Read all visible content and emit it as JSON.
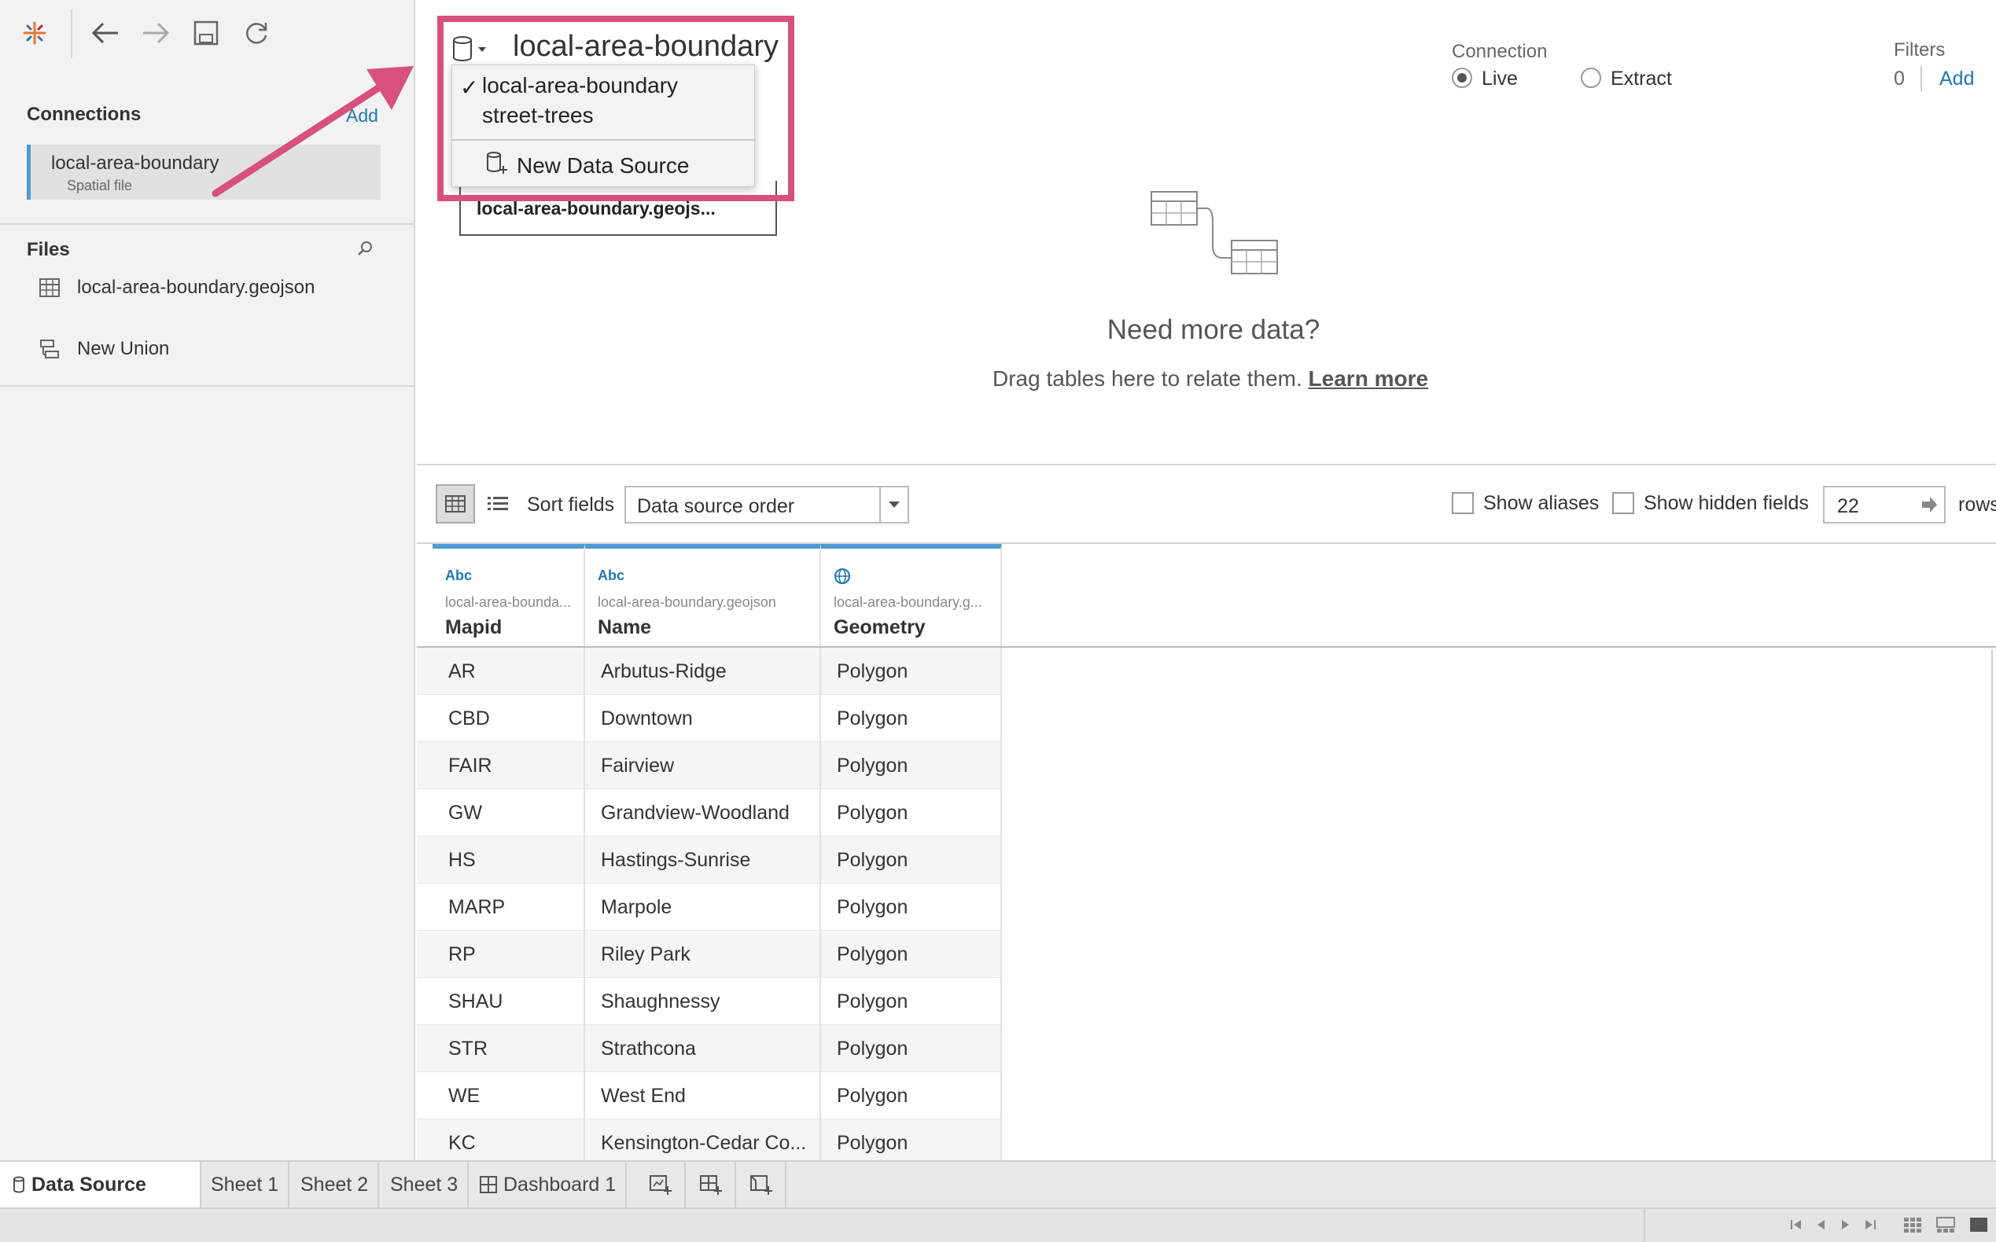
{
  "toolbar": {
    "icons": [
      "tableau-logo-icon",
      "back-icon",
      "forward-icon",
      "save-icon",
      "refresh-icon"
    ]
  },
  "sidebar": {
    "connections_title": "Connections",
    "connections_add": "Add",
    "connection": {
      "name": "local-area-boundary",
      "type": "Spatial file"
    },
    "files_title": "Files",
    "files": [
      {
        "label": "local-area-boundary.geojson",
        "icon": "table-icon"
      },
      {
        "label": "New Union",
        "icon": "union-icon"
      }
    ]
  },
  "header": {
    "datasource_title": "local-area-boundary",
    "dropdown": {
      "items": [
        "local-area-boundary",
        "street-trees"
      ],
      "checked_index": 0,
      "new_source": "New Data Source"
    },
    "table_card": "local-area-boundary.geojs...",
    "connection_label": "Connection",
    "connection_options": [
      "Live",
      "Extract"
    ],
    "connection_selected": "Live",
    "filters_label": "Filters",
    "filters_count": "0",
    "filters_add": "Add",
    "need_more": "Need more data?",
    "drag_text": "Drag tables here to relate them.",
    "learn_more": "Learn more"
  },
  "grid_toolbar": {
    "sort_label": "Sort fields",
    "sort_value": "Data source order",
    "show_aliases": "Show aliases",
    "show_hidden": "Show hidden fields",
    "rows_value": "22",
    "rows_label": "rows"
  },
  "grid": {
    "columns": [
      {
        "type": "Abc",
        "source": "local-area-bounda...",
        "name": "Mapid"
      },
      {
        "type": "Abc",
        "source": "local-area-boundary.geojson",
        "name": "Name"
      },
      {
        "type": "globe",
        "source": "local-area-boundary.g...",
        "name": "Geometry"
      }
    ],
    "rows": [
      [
        "AR",
        "Arbutus-Ridge",
        "Polygon"
      ],
      [
        "CBD",
        "Downtown",
        "Polygon"
      ],
      [
        "FAIR",
        "Fairview",
        "Polygon"
      ],
      [
        "GW",
        "Grandview-Woodland",
        "Polygon"
      ],
      [
        "HS",
        "Hastings-Sunrise",
        "Polygon"
      ],
      [
        "MARP",
        "Marpole",
        "Polygon"
      ],
      [
        "RP",
        "Riley Park",
        "Polygon"
      ],
      [
        "SHAU",
        "Shaughnessy",
        "Polygon"
      ],
      [
        "STR",
        "Strathcona",
        "Polygon"
      ],
      [
        "WE",
        "West End",
        "Polygon"
      ],
      [
        "KC",
        "Kensington-Cedar Co...",
        "Polygon"
      ]
    ]
  },
  "tabs": {
    "data_source": "Data Source",
    "sheets": [
      "Sheet 1",
      "Sheet 2",
      "Sheet 3"
    ],
    "dashboard": "Dashboard 1"
  },
  "colors": {
    "highlight": "#d8507f",
    "accent": "#4e9ad3",
    "link": "#1f77b4"
  }
}
